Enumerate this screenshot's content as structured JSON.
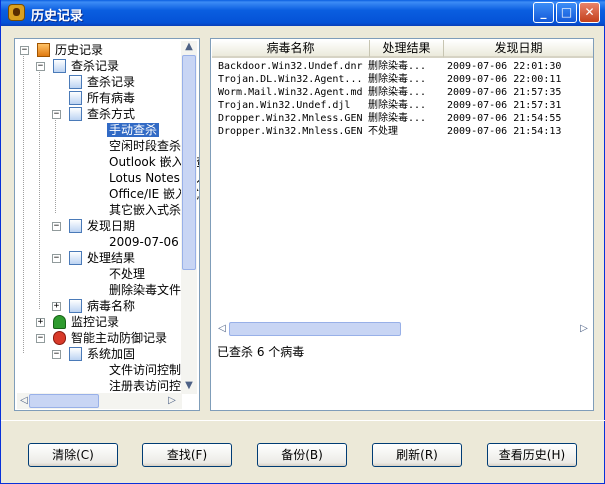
{
  "window": {
    "title": "历史记录",
    "controls": {
      "min": "_",
      "max": "□",
      "close": "✕"
    }
  },
  "tree": {
    "nodes": [
      {
        "label": "历史记录",
        "icon": "history-root-icon",
        "exp": "−"
      },
      {
        "label": "查杀记录",
        "icon": "document-icon",
        "exp": "−"
      },
      {
        "label": "查杀记录",
        "icon": "document-icon",
        "exp": ""
      },
      {
        "label": "所有病毒",
        "icon": "document-icon",
        "exp": ""
      },
      {
        "label": "查杀方式",
        "icon": "document-icon",
        "exp": "−"
      },
      {
        "label": "手动查杀",
        "icon": "",
        "exp": "",
        "selected": true
      },
      {
        "label": "空闲时段查杀",
        "icon": "",
        "exp": ""
      },
      {
        "label": "Outlook 嵌入式查杀",
        "icon": "",
        "exp": ""
      },
      {
        "label": "Lotus Notes 嵌入式",
        "icon": "",
        "exp": ""
      },
      {
        "label": "Office/IE 嵌入式",
        "icon": "",
        "exp": ""
      },
      {
        "label": "其它嵌入式杀毒",
        "icon": "",
        "exp": ""
      },
      {
        "label": "发现日期",
        "icon": "document-icon",
        "exp": "−"
      },
      {
        "label": "2009-07-06",
        "icon": "",
        "exp": ""
      },
      {
        "label": "处理结果",
        "icon": "document-icon",
        "exp": "−"
      },
      {
        "label": "不处理",
        "icon": "",
        "exp": ""
      },
      {
        "label": "删除染毒文件",
        "icon": "",
        "exp": ""
      },
      {
        "label": "病毒名称",
        "icon": "document-icon",
        "exp": "+"
      },
      {
        "label": "监控记录",
        "icon": "umbrella-icon",
        "exp": "+"
      },
      {
        "label": "智能主动防御记录",
        "icon": "shield-icon",
        "exp": "−"
      },
      {
        "label": "系统加固",
        "icon": "document-icon",
        "exp": "−"
      },
      {
        "label": "文件访问控制",
        "icon": "",
        "exp": ""
      },
      {
        "label": "注册表访问控制",
        "icon": "",
        "exp": ""
      }
    ],
    "scroll": {
      "up": "▲",
      "down": "▼",
      "left": "◁",
      "right": "▷"
    }
  },
  "list": {
    "columns": [
      "病毒名称",
      "处理结果",
      "发现日期"
    ],
    "rows": [
      [
        "Backdoor.Win32.Undef.dnr",
        "删除染毒...",
        "2009-07-06  22:01:30"
      ],
      [
        "Trojan.DL.Win32.Agent...",
        "删除染毒...",
        "2009-07-06  22:00:11"
      ],
      [
        "Worm.Mail.Win32.Agent.md",
        "删除染毒...",
        "2009-07-06  21:57:35"
      ],
      [
        "Trojan.Win32.Undef.djl",
        "删除染毒...",
        "2009-07-06  21:57:31"
      ],
      [
        "Dropper.Win32.Mnless.GEN",
        "删除染毒...",
        "2009-07-06  21:54:55"
      ],
      [
        "Dropper.Win32.Mnless.GEN",
        "不处理",
        "2009-07-06  21:54:13"
      ]
    ],
    "status": "已查杀 6 个病毒",
    "scroll": {
      "left": "◁",
      "right": "▷"
    }
  },
  "buttons": {
    "clear": "清除(C)",
    "find": "查找(F)",
    "backup": "备份(B)",
    "refresh": "刷新(R)",
    "view_history": "查看历史(H)"
  }
}
